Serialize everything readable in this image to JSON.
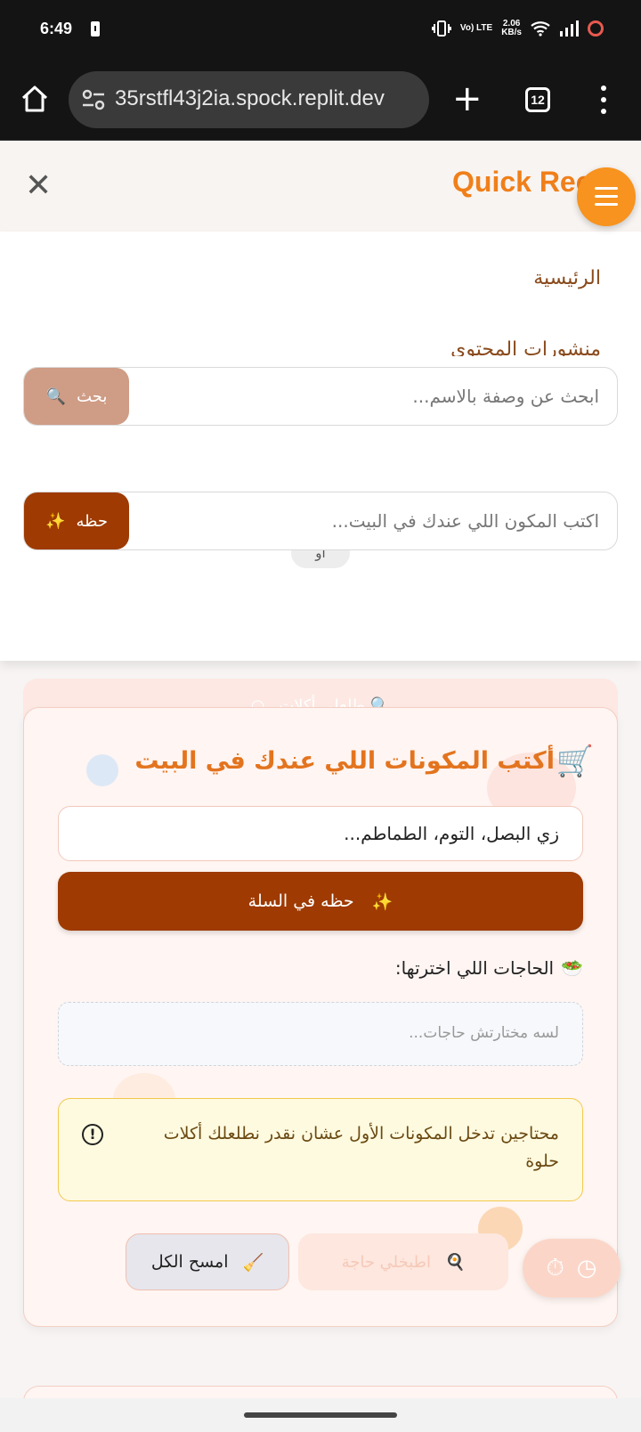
{
  "status_bar": {
    "time": "6:49",
    "network_label": "Vo) LTE",
    "speed_value": "2.06",
    "speed_unit": "KB/s"
  },
  "browser": {
    "url": "35rstfl43j2ia.spock.replit.dev",
    "tab_count": "12"
  },
  "header": {
    "brand": "Quick Reci"
  },
  "drawer": {
    "nav_items": [
      "الرئيسية",
      "منشورات المحتوى"
    ],
    "search_placeholder": "ابحث عن وصفة بالاسم...",
    "search_button": "بحث",
    "or_label": "أو",
    "ingredient_placeholder": "اكتب المكون اللي عندك في البيت...",
    "save_button": "حظه",
    "suggest_button": "🔍 طلعلي أكلات"
  },
  "card": {
    "title": "أكتب المكونات اللي عندك في البيت",
    "input_placeholder": "زي البصل، التوم، الطماطم...",
    "add_button": "حظه في السلة",
    "picked_label": "الحاجات اللي اخترتها:",
    "empty_text": "لسه مختارتش حاجات...",
    "alert_text": "محتاجين تدخل المكونات الأول عشان نقدر نطلعلك أكلات حلوة",
    "clear_button": "امسح الكل",
    "cook_button": "اطبخلي حاجة"
  },
  "colors": {
    "brand_orange": "#f07f1a",
    "primary_brown": "#9e3a02",
    "search_button_bg": "#cf9c85",
    "alert_bg": "#fefae0",
    "alert_border": "#f2c94c"
  }
}
